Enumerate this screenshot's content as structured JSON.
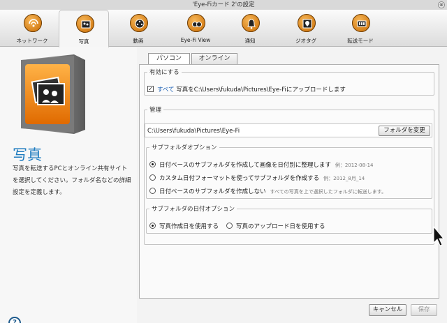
{
  "window": {
    "title": "'Eye-Fiカード 2'の設定",
    "close_glyph": "⊗"
  },
  "toolbar": {
    "items": [
      {
        "label": "ネットワーク",
        "icon": "network-icon"
      },
      {
        "label": "写真",
        "icon": "photos-icon"
      },
      {
        "label": "動画",
        "icon": "video-icon"
      },
      {
        "label": "Eye-Fi View",
        "icon": "eyefi-view-icon"
      },
      {
        "label": "通知",
        "icon": "notification-bell-icon"
      },
      {
        "label": "ジオタグ",
        "icon": "geotag-icon"
      },
      {
        "label": "転送モード",
        "icon": "transfer-mode-icon"
      }
    ],
    "active_index": 1
  },
  "left": {
    "title": "写真",
    "description": "写真を転送するPCとオンライン共有サイトを選択してください。フォルダ名などの詳細設定を定義します。",
    "help_glyph": "?"
  },
  "tabs": [
    {
      "label": "パソコン",
      "active": true
    },
    {
      "label": "オンライン",
      "active": false
    }
  ],
  "enable": {
    "legend": "有効にする",
    "checked": true,
    "check_glyph": "✓",
    "link_text": "すべて",
    "text": "写真をC:\\Users\\fukuda\\Pictures\\Eye-Fiにアップロードします"
  },
  "manage": {
    "legend": "管理",
    "path": "C:\\Users\\fukuda\\Pictures\\Eye-Fi",
    "change_folder_label": "フォルダを変更"
  },
  "subfolder": {
    "legend": "サブフォルダオプション",
    "options": [
      {
        "label": "日付ベースのサブフォルダを作成して画像を日付別に整理します",
        "example": "例：2012-08-14",
        "selected": true
      },
      {
        "label": "カスタム日付フォーマットを使ってサブフォルダを作成する",
        "example": "例：2012_8月_14",
        "selected": false
      },
      {
        "label": "日付ベースのサブフォルダを作成しない",
        "example": "すべての写真を上で選択したフォルダに転送します。",
        "selected": false
      }
    ]
  },
  "date_option": {
    "legend": "サブフォルダの日付オプション",
    "options": [
      {
        "label": "写真作成日を使用する",
        "selected": true
      },
      {
        "label": "写真のアップロード日を使用する",
        "selected": false
      }
    ]
  },
  "footer": {
    "cancel_label": "キャンセル",
    "save_label": "保存"
  },
  "colors": {
    "accent": "#1d7bbf",
    "link": "#1a5fb4",
    "icon_orange": "#f0861a"
  }
}
